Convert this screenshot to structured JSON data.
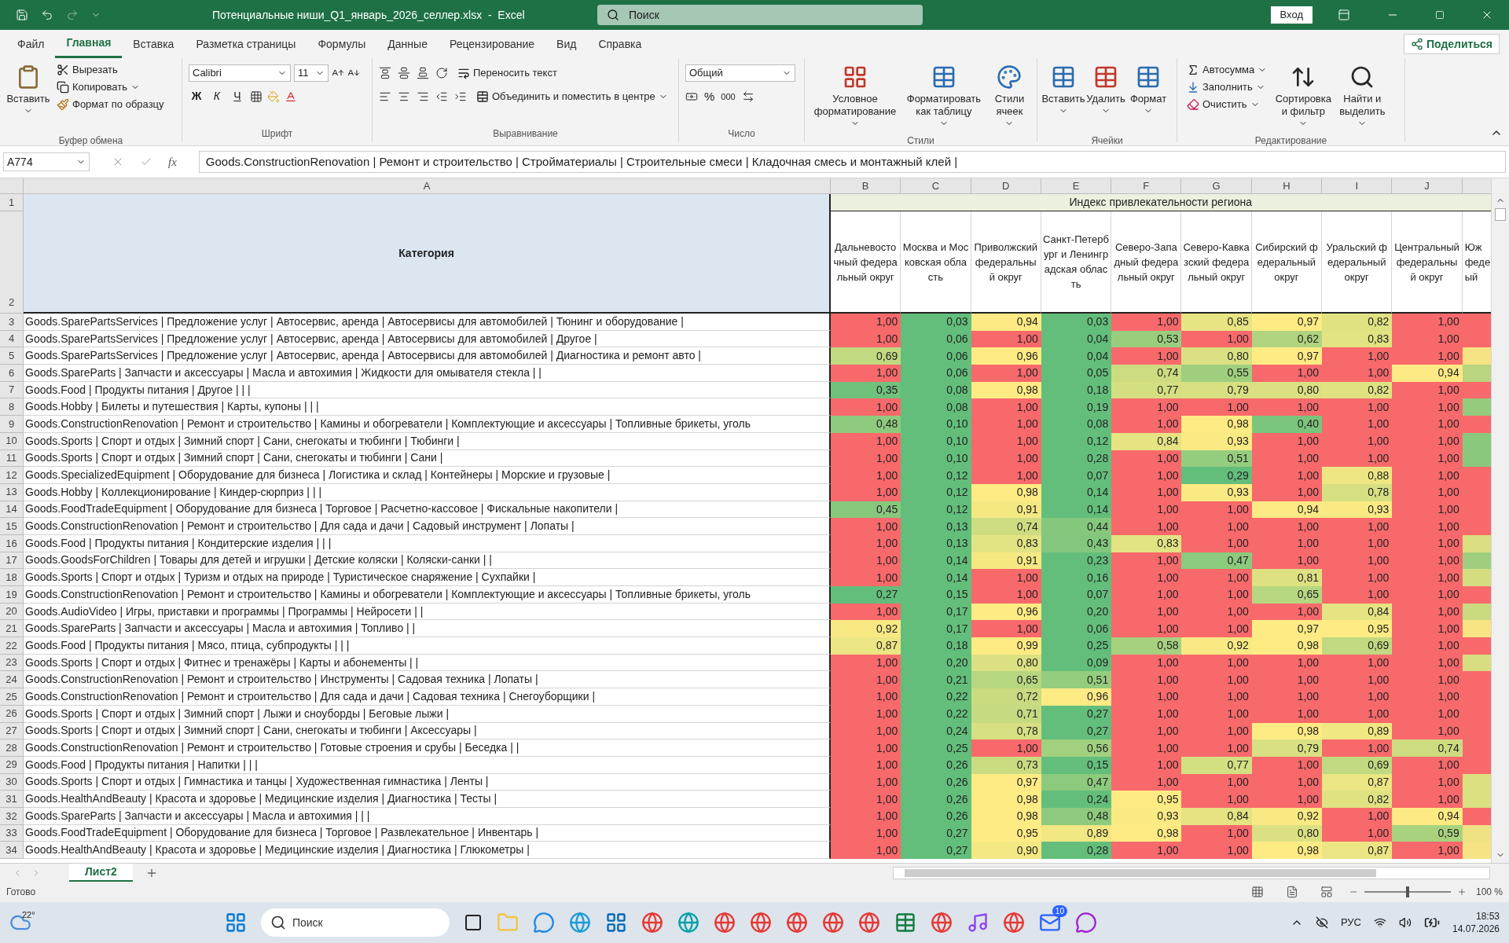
{
  "title_bar": {
    "title": "Потенциальные ниши_Q1_январь_2026_селлер.xlsx  -  Excel",
    "search_placeholder": "Поиск",
    "sign_in": "Вход"
  },
  "menu_tabs": [
    {
      "label": "Файл",
      "selected": false
    },
    {
      "label": "Главная",
      "selected": true
    },
    {
      "label": "Вставка",
      "selected": false
    },
    {
      "label": "Разметка страницы",
      "selected": false
    },
    {
      "label": "Формулы",
      "selected": false
    },
    {
      "label": "Данные",
      "selected": false
    },
    {
      "label": "Рецензирование",
      "selected": false
    },
    {
      "label": "Вид",
      "selected": false
    },
    {
      "label": "Справка",
      "selected": false
    }
  ],
  "share": "Поделиться",
  "ribbon": {
    "clipboard": {
      "group": "Буфер обмена",
      "paste": "Вставить",
      "cut": "Вырезать",
      "copy": "Копировать",
      "format_painter": "Формат по образцу"
    },
    "font": {
      "group": "Шрифт",
      "name": "Calibri",
      "size": "11",
      "bold": "Ж",
      "italic": "К",
      "underline": "Ч"
    },
    "alignment": {
      "group": "Выравнивание",
      "wrap": "Переносить текст",
      "merge": "Объединить и поместить в центре"
    },
    "number": {
      "group": "Число",
      "format": "Общий",
      "percent": "%",
      "thousands": "000"
    },
    "styles": {
      "group": "Стили",
      "items": [
        "Условное форматирование",
        "Форматировать как таблицу",
        "Стили ячеек"
      ]
    },
    "cells": {
      "group": "Ячейки",
      "items": [
        "Вставить",
        "Удалить",
        "Формат"
      ]
    },
    "editing": {
      "group": "Редактирование",
      "autosum": "Автосумма",
      "fill": "Заполнить",
      "clear": "Очистить",
      "sort": "Сортировка и фильтр",
      "find": "Найти и выделить"
    }
  },
  "formula_bar": {
    "name_box": "A774",
    "fx": "fx",
    "formula": "Goods.ConstructionRenovation | Ремонт и строительство | Стройматериалы | Строительные смеси | Кладочная смесь и монтажный клей |"
  },
  "sheet": {
    "columns": [
      "A",
      "B",
      "C",
      "D",
      "E",
      "F",
      "G",
      "H",
      "I",
      "J"
    ],
    "header_rows": [
      "1",
      "2"
    ],
    "category_header": "Категория",
    "merged_header": "Индекс привлекательности региона",
    "region_headers": [
      "Дальневосточный федеральный округ",
      "Москва и Московская область",
      "Приволжский федеральный округ",
      "Санкт-Петербург и Ленинградская область",
      "Северо-Западный федеральный округ",
      "Северо-Кавказский федеральный округ",
      "Сибирский федеральный округ",
      "Уральский федеральный округ",
      "Центральный федеральный округ"
    ],
    "partial_header": [
      "Юж",
      "феде",
      "ый"
    ],
    "rows": [
      {
        "n": "3",
        "category": "Goods.SparePartsServices | Предложение услуг | Автосервис, аренда | Автосервисы для автомобилей | Тюнинг и оборудование |",
        "values": [
          "1,00",
          "0,03",
          "0,94",
          "0,03",
          "1,00",
          "0,85",
          "0,97",
          "0,82",
          "1,00"
        ],
        "color": "#f8696b"
      },
      {
        "n": "4",
        "category": "Goods.SparePartsServices | Предложение услуг | Автосервис, аренда | Автосервисы для автомобилей | Другое |",
        "values": [
          "1,00",
          "0,06",
          "1,00",
          "0,04",
          "0,53",
          "1,00",
          "0,62",
          "0,83",
          "1,00"
        ],
        "color": "#f8696b"
      },
      {
        "n": "5",
        "category": "Goods.SparePartsServices | Предложение услуг | Автосервис, аренда | Автосервисы для автомобилей | Диагностика и ремонт авто |",
        "values": [
          "0,69",
          "0,06",
          "0,96",
          "0,04",
          "1,00",
          "0,80",
          "0,97",
          "1,00",
          "1,00"
        ],
        "color": "#f6e383"
      },
      {
        "n": "6",
        "category": "Goods.SpareParts | Запчасти и аксессуары | Масла и автохимия | Жидкости для омывателя стекла |  |",
        "values": [
          "1,00",
          "0,06",
          "1,00",
          "0,05",
          "0,74",
          "0,55",
          "1,00",
          "1,00",
          "0,94"
        ],
        "color": "#b9d57f"
      },
      {
        "n": "7",
        "category": "Goods.Food | Продукты питания | Другое |  |  |",
        "values": [
          "0,35",
          "0,08",
          "0,98",
          "0,18",
          "0,77",
          "0,79",
          "0,80",
          "0,82",
          "1,00"
        ],
        "color": "#f8696b"
      },
      {
        "n": "8",
        "category": "Goods.Hobby | Билеты и путешествия | Карты, купоны |  |  |",
        "values": [
          "1,00",
          "0,08",
          "1,00",
          "0,19",
          "1,00",
          "1,00",
          "1,00",
          "1,00",
          "1,00"
        ],
        "color": "#94cb7d"
      },
      {
        "n": "9",
        "category": "Goods.ConstructionRenovation | Ремонт и строительство | Камины и обогреватели | Комплектующие и аксессуары | Топливные брикеты, уголь",
        "values": [
          "0,48",
          "0,10",
          "1,00",
          "0,08",
          "1,00",
          "0,98",
          "0,40",
          "1,00",
          "1,00"
        ],
        "color": "#f8696b"
      },
      {
        "n": "10",
        "category": "Goods.Sports | Спорт и отдых | Зимний спорт | Сани, снегокаты и тюбинги | Тюбинги |",
        "values": [
          "1,00",
          "0,10",
          "1,00",
          "0,12",
          "0,84",
          "0,93",
          "1,00",
          "1,00",
          "1,00"
        ],
        "color": "#8ac97d"
      },
      {
        "n": "11",
        "category": "Goods.Sports | Спорт и отдых | Зимний спорт | Сани, снегокаты и тюбинги | Сани |",
        "values": [
          "1,00",
          "0,10",
          "1,00",
          "0,28",
          "1,00",
          "0,51",
          "1,00",
          "1,00",
          "1,00"
        ],
        "color": "#8ac97d"
      },
      {
        "n": "12",
        "category": "Goods.SpecializedEquipment | Оборудование для бизнеса | Логистика и склад | Контейнеры | Морские и грузовые |",
        "values": [
          "1,00",
          "0,12",
          "1,00",
          "0,07",
          "1,00",
          "0,29",
          "1,00",
          "0,88",
          "1,00"
        ],
        "color": "#f8696b"
      },
      {
        "n": "13",
        "category": "Goods.Hobby | Коллекционирование | Киндер-сюрприз |  |  |",
        "values": [
          "1,00",
          "0,12",
          "0,98",
          "0,14",
          "1,00",
          "0,93",
          "1,00",
          "0,78",
          "1,00"
        ],
        "color": "#f8696b"
      },
      {
        "n": "14",
        "category": "Goods.FoodTradeEquipment | Оборудование для бизнеса | Торговое | Расчетно-кассовое | Фискальные накопители |",
        "values": [
          "0,45",
          "0,12",
          "0,91",
          "0,14",
          "1,00",
          "1,00",
          "0,94",
          "0,93",
          "1,00"
        ],
        "color": "#f8696b"
      },
      {
        "n": "15",
        "category": "Goods.ConstructionRenovation | Ремонт и строительство | Для сада и дачи | Садовый инструмент | Лопаты |",
        "values": [
          "1,00",
          "0,13",
          "0,74",
          "0,44",
          "1,00",
          "1,00",
          "1,00",
          "1,00",
          "1,00"
        ],
        "color": "#f8696b"
      },
      {
        "n": "16",
        "category": "Goods.Food | Продукты питания | Кондитерские изделия |  |  |",
        "values": [
          "1,00",
          "0,13",
          "0,83",
          "0,43",
          "0,83",
          "1,00",
          "1,00",
          "1,00",
          "1,00"
        ],
        "color": "#dbdf81"
      },
      {
        "n": "17",
        "category": "Goods.GoodsForChildren | Товары для детей и игрушки | Детские коляски | Коляски-санки |  |",
        "values": [
          "1,00",
          "0,14",
          "0,91",
          "0,23",
          "1,00",
          "0,47",
          "1,00",
          "1,00",
          "1,00"
        ],
        "color": "#9fce7e"
      },
      {
        "n": "18",
        "category": "Goods.Sports | Спорт и отдых | Туризм и отдых на природе | Туристическое снаряжение | Сухпайки |",
        "values": [
          "1,00",
          "0,14",
          "1,00",
          "0,16",
          "1,00",
          "1,00",
          "0,81",
          "1,00",
          "1,00"
        ],
        "color": "#d5dd81"
      },
      {
        "n": "19",
        "category": "Goods.ConstructionRenovation | Ремонт и строительство | Камины и обогреватели | Комплектующие и аксессуары | Топливные брикеты, уголь",
        "values": [
          "0,27",
          "0,15",
          "1,00",
          "0,07",
          "1,00",
          "1,00",
          "0,65",
          "1,00",
          "1,00"
        ],
        "color": "#f8696b"
      },
      {
        "n": "20",
        "category": "Goods.AudioVideo | Игры, приставки и программы | Программы | Нейросети |  |",
        "values": [
          "1,00",
          "0,17",
          "0,96",
          "0,20",
          "1,00",
          "1,00",
          "1,00",
          "0,84",
          "1,00"
        ],
        "color": "#c9da80"
      },
      {
        "n": "21",
        "category": "Goods.SpareParts | Запчасти и аксессуары | Масла и автохимия | Топливо |  |",
        "values": [
          "0,92",
          "0,17",
          "1,00",
          "0,06",
          "1,00",
          "1,00",
          "0,97",
          "0,95",
          "1,00"
        ],
        "color": "#f8e483"
      },
      {
        "n": "22",
        "category": "Goods.Food | Продукты питания | Мясо, птица, субпродукты |  |  |",
        "values": [
          "0,87",
          "0,18",
          "0,99",
          "0,25",
          "0,58",
          "0,92",
          "0,98",
          "0,69",
          "1,00"
        ],
        "color": "#f8696b"
      },
      {
        "n": "23",
        "category": "Goods.Sports | Спорт и отдых | Фитнес и тренажёры | Карты и абонементы |  |",
        "values": [
          "1,00",
          "0,20",
          "0,80",
          "0,09",
          "1,00",
          "1,00",
          "1,00",
          "1,00",
          "1,00"
        ],
        "color": "#d7de81"
      },
      {
        "n": "24",
        "category": "Goods.ConstructionRenovation | Ремонт и строительство | Инструменты | Садовая техника | Лопаты |",
        "values": [
          "1,00",
          "0,21",
          "0,65",
          "0,51",
          "1,00",
          "1,00",
          "1,00",
          "1,00",
          "1,00"
        ],
        "color": "#f8696b"
      },
      {
        "n": "25",
        "category": "Goods.ConstructionRenovation | Ремонт и строительство | Для сада и дачи | Садовая техника | Снегоуборщики |",
        "values": [
          "1,00",
          "0,22",
          "0,72",
          "0,96",
          "1,00",
          "1,00",
          "1,00",
          "1,00",
          "1,00"
        ],
        "color": "#f8696b"
      },
      {
        "n": "26",
        "category": "Goods.Sports | Спорт и отдых | Зимний спорт | Лыжи и сноуборды | Беговые лыжи |",
        "values": [
          "1,00",
          "0,22",
          "0,71",
          "0,27",
          "1,00",
          "1,00",
          "1,00",
          "1,00",
          "1,00"
        ],
        "color": "#f8696b"
      },
      {
        "n": "27",
        "category": "Goods.Sports | Спорт и отдых | Зимний спорт | Сани, снегокаты и тюбинги | Аксессуары |",
        "values": [
          "1,00",
          "0,24",
          "0,78",
          "0,27",
          "1,00",
          "1,00",
          "0,98",
          "0,89",
          "1,00"
        ],
        "color": "#f8696b"
      },
      {
        "n": "28",
        "category": "Goods.ConstructionRenovation | Ремонт и строительство | Готовые строения и срубы | Беседка |  |",
        "values": [
          "1,00",
          "0,25",
          "1,00",
          "0,56",
          "1,00",
          "1,00",
          "0,79",
          "1,00",
          "0,74"
        ],
        "color": "#f8696b"
      },
      {
        "n": "29",
        "category": "Goods.Food | Продукты питания | Напитки |  |  |",
        "values": [
          "1,00",
          "0,26",
          "0,73",
          "0,15",
          "1,00",
          "0,77",
          "1,00",
          "0,69",
          "1,00"
        ],
        "color": "#f8696b"
      },
      {
        "n": "30",
        "category": "Goods.Sports | Спорт и отдых | Гимнастика и танцы | Художественная гимнастика | Ленты |",
        "values": [
          "1,00",
          "0,26",
          "0,97",
          "0,47",
          "1,00",
          "1,00",
          "1,00",
          "0,87",
          "1,00"
        ],
        "color": "#dbe081"
      },
      {
        "n": "31",
        "category": "Goods.HealthAndBeauty | Красота и здоровье | Медицинские изделия | Диагностика | Тесты |",
        "values": [
          "1,00",
          "0,26",
          "0,98",
          "0,24",
          "0,95",
          "1,00",
          "1,00",
          "0,82",
          "1,00"
        ],
        "color": "#dbe081"
      },
      {
        "n": "32",
        "category": "Goods.SpareParts | Запчасти и аксессуары | Масла и автохимия |  |  |",
        "values": [
          "1,00",
          "0,26",
          "0,98",
          "0,48",
          "0,93",
          "0,84",
          "0,92",
          "1,00",
          "0,94"
        ],
        "color": "#f8696b"
      },
      {
        "n": "33",
        "category": "Goods.FoodTradeEquipment | Оборудование для бизнеса | Торговое | Развлекательное | Инвентарь |",
        "values": [
          "1,00",
          "0,27",
          "0,95",
          "0,89",
          "0,98",
          "1,00",
          "0,80",
          "1,00",
          "0,59"
        ],
        "color": "#eee283"
      },
      {
        "n": "34",
        "category": "Goods.HealthAndBeauty | Красота и здоровье | Медицинские изделия | Диагностика | Глюкометры |",
        "values": [
          "1,00",
          "0,27",
          "0,90",
          "0,28",
          "1,00",
          "1,00",
          "0,98",
          "0,87",
          "1,00"
        ],
        "color": "#f6e383"
      }
    ]
  },
  "sheet_tabs": [
    {
      "label": "Лист2",
      "selected": true
    }
  ],
  "status_bar": {
    "status": "Готово",
    "zoom": "100 %",
    "level": 0.5
  },
  "taskbar": {
    "weather": "22°",
    "search_placeholder": "Поиск",
    "badge": "10",
    "lang": "РУС",
    "time": "18:53",
    "date": "14.07.2026"
  }
}
